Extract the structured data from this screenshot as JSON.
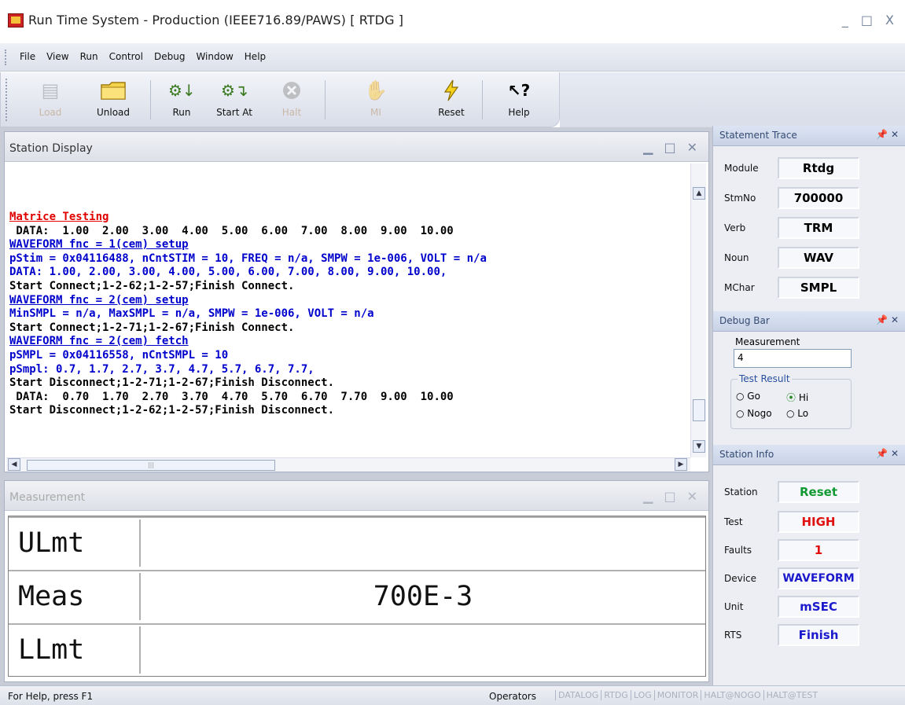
{
  "window": {
    "title": "Run Time System - Production (IEEE716.89/PAWS)  [ RTDG ]",
    "controls": [
      "_",
      "□",
      "X"
    ]
  },
  "menu": [
    "File",
    "View",
    "Run",
    "Control",
    "Debug",
    "Window",
    "Help"
  ],
  "toolbar": [
    {
      "label": "Load",
      "icon": "load-icon",
      "enabled": false
    },
    {
      "label": "Unload",
      "icon": "folder-icon",
      "enabled": true
    },
    {
      "label": "Run",
      "icon": "run-icon",
      "enabled": true
    },
    {
      "label": "Start At",
      "icon": "start-at-icon",
      "enabled": true
    },
    {
      "label": "Halt",
      "icon": "halt-icon",
      "enabled": false
    },
    {
      "label": "MI",
      "icon": "mi-icon",
      "enabled": false
    },
    {
      "label": "Reset",
      "icon": "lightning-icon",
      "enabled": true
    },
    {
      "label": "Help",
      "icon": "help-icon",
      "enabled": true
    }
  ],
  "station_display": {
    "title": "Station Display",
    "lines": [
      {
        "text": "Matrice Testing",
        "style": "red"
      },
      {
        "text": " DATA:  1.00  2.00  3.00  4.00  5.00  6.00  7.00  8.00  9.00  10.00",
        "style": "blk"
      },
      {
        "text": "WAVEFORM fnc = 1(cem) setup",
        "style": "blu-u"
      },
      {
        "text": "pStim = 0x04116488, nCntSTIM = 10, FREQ = n/a, SMPW = 1e-006, VOLT = n/a",
        "style": "blu"
      },
      {
        "text": "DATA: 1.00, 2.00, 3.00, 4.00, 5.00, 6.00, 7.00, 8.00, 9.00, 10.00,",
        "style": "blu"
      },
      {
        "text": "Start Connect;1-2-62;1-2-57;Finish Connect.",
        "style": "blk"
      },
      {
        "text": "WAVEFORM fnc = 2(cem) setup",
        "style": "blu-u"
      },
      {
        "text": "MinSMPL = n/a, MaxSMPL = n/a, SMPW = 1e-006, VOLT = n/a",
        "style": "blu"
      },
      {
        "text": "Start Connect;1-2-71;1-2-67;Finish Connect.",
        "style": "blk"
      },
      {
        "text": "WAVEFORM fnc = 2(cem) fetch",
        "style": "blu-u"
      },
      {
        "text": "pSMPL = 0x04116558, nCntSMPL = 10",
        "style": "blu"
      },
      {
        "text": "pSmpl: 0.7, 1.7, 2.7, 3.7, 4.7, 5.7, 6.7, 7.7,",
        "style": "blu"
      },
      {
        "text": "Start Disconnect;1-2-71;1-2-67;Finish Disconnect.",
        "style": "blk"
      },
      {
        "text": " DATA:  0.70  1.70  2.70  3.70  4.70  5.70  6.70  7.70  9.00  10.00",
        "style": "blk"
      },
      {
        "text": "Start Disconnect;1-2-62;1-2-57;Finish Disconnect.",
        "style": "blk"
      }
    ]
  },
  "measurement": {
    "title": "Measurement",
    "rows": [
      {
        "key": "ULmt",
        "value": ""
      },
      {
        "key": "Meas",
        "value": "700E-3"
      },
      {
        "key": "LLmt",
        "value": ""
      }
    ]
  },
  "statement_trace": {
    "title": "Statement Trace",
    "fields": [
      {
        "label": "Module",
        "value": "Rtdg"
      },
      {
        "label": "StmNo",
        "value": "700000"
      },
      {
        "label": "Verb",
        "value": "TRM"
      },
      {
        "label": "Noun",
        "value": "WAV"
      },
      {
        "label": "MChar",
        "value": "SMPL"
      }
    ]
  },
  "debug_bar": {
    "title": "Debug Bar",
    "measurement_label": "Measurement",
    "measurement_value": "4",
    "test_result_label": "Test Result",
    "options": [
      {
        "label": "Go",
        "checked": false
      },
      {
        "label": "Hi",
        "checked": true
      },
      {
        "label": "Nogo",
        "checked": false
      },
      {
        "label": "Lo",
        "checked": false
      }
    ]
  },
  "station_info": {
    "title": "Station Info",
    "fields": [
      {
        "label": "Station",
        "value": "Reset",
        "color": "#119933"
      },
      {
        "label": "Test",
        "value": "HIGH",
        "color": "#e01010"
      },
      {
        "label": "Faults",
        "value": "1",
        "color": "#e01010"
      },
      {
        "label": "Device",
        "value": "WAVEFORM",
        "color": "#1a1acc"
      },
      {
        "label": "Unit",
        "value": "mSEC",
        "color": "#1a1acc"
      },
      {
        "label": "RTS",
        "value": "Finish",
        "color": "#1a1acc"
      }
    ]
  },
  "statusbar": {
    "help": "For Help, press F1",
    "operators": "Operators",
    "indicators": [
      "DATALOG",
      "RTDG",
      "LOG",
      "MONITOR",
      "HALT@NOGO",
      "HALT@TEST"
    ]
  }
}
